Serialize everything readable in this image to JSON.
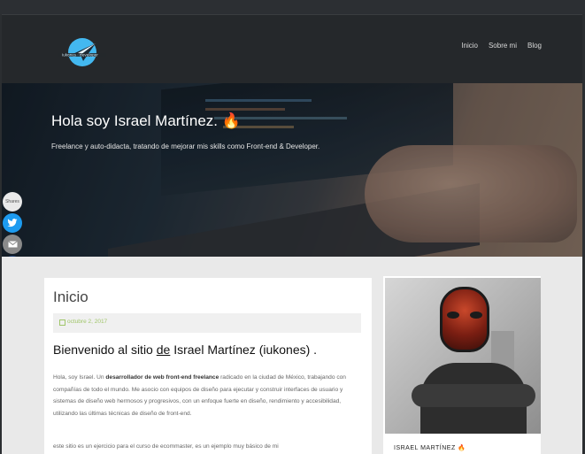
{
  "nav": {
    "items": [
      "Inicio",
      "Sobre mi",
      "Blog"
    ]
  },
  "logo": {
    "icon": "plane-logo-icon",
    "brand_color": "#43b8f0"
  },
  "hero": {
    "title": "Hola soy Israel Martínez.",
    "title_emoji": "🔥",
    "subtitle": "Freelance y auto-didacta, tratando de mejorar mis skills como Front-end & Developer."
  },
  "share": {
    "count_label": "Shares",
    "buttons": [
      "twitter-icon",
      "email-icon",
      "crown-icon"
    ]
  },
  "post": {
    "heading": "Inicio",
    "date": "octubre 2, 2017",
    "welcome_before": "Bienvenido al sitio ",
    "welcome_link": "de",
    "welcome_after": " Israel Martínez (iukones) .",
    "para_start": "Hola, soy Israel. Un ",
    "para_bold": "desarrollador de web front-end freelance",
    "para_rest": " radicado en la ciudad de México, trabajando con compañías de todo el mundo. Me asocio con equipos de diseño para ejecutar y construir interfaces de usuario y sistemas de diseño web hermosos y progresivos, con un enfoque fuerte en diseño, rendimiento y accesibilidad, utilizando las últimas técnicas de diseño de front-end.",
    "para2": "este sitio es un ejercicio para el curso de ecommaster, es un ejemplo muy básico de mi"
  },
  "sidebar": {
    "caption": "ISRAEL MARTÍNEZ",
    "caption_emoji": "🔥"
  },
  "colors": {
    "accent": "#a0c66a",
    "twitter": "#1d9bf0",
    "header_bg": "#25282b"
  }
}
